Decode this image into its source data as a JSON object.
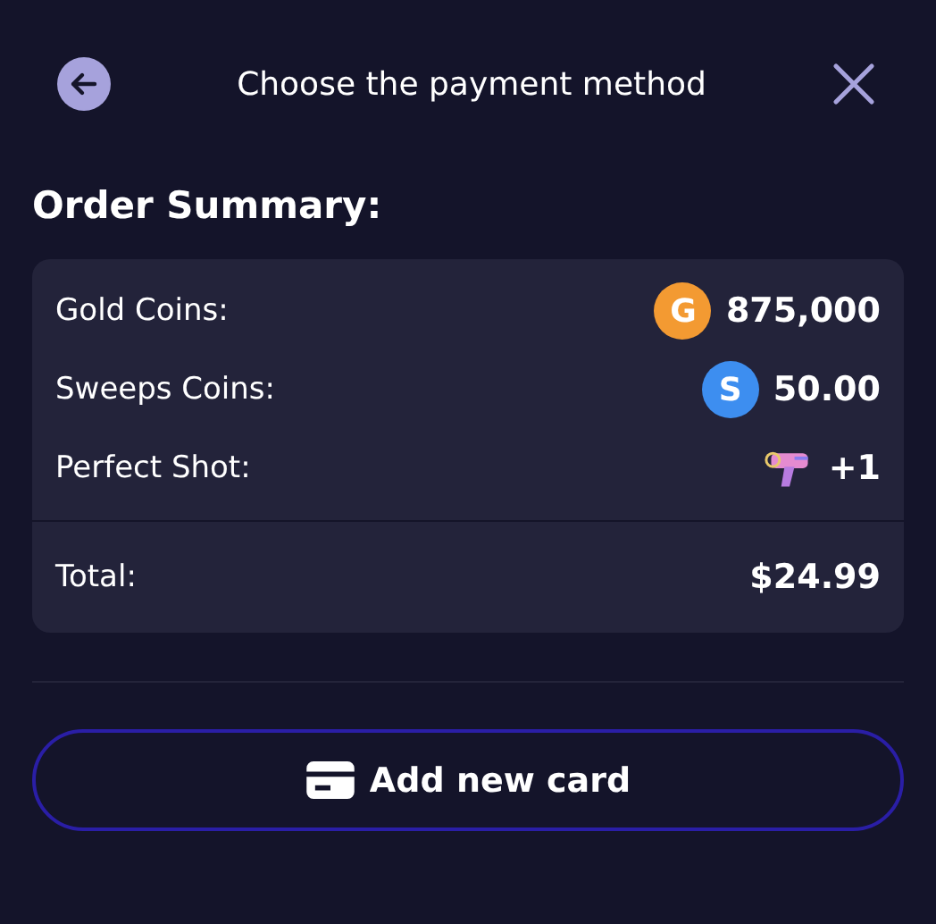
{
  "header": {
    "title": "Choose the payment method"
  },
  "summary": {
    "heading": "Order Summary:",
    "items": [
      {
        "label": "Gold Coins:",
        "kind": "coin",
        "coin_letter": "G",
        "color": "#f39a32",
        "value": "875,000"
      },
      {
        "label": "Sweeps Coins:",
        "kind": "coin",
        "coin_letter": "S",
        "color": "#3d8ef0",
        "value": "50.00"
      },
      {
        "label": "Perfect Shot:",
        "kind": "item",
        "value": "+1"
      }
    ],
    "total": {
      "label": "Total:",
      "value": "$24.99"
    }
  },
  "button": {
    "label": "Add new card"
  }
}
